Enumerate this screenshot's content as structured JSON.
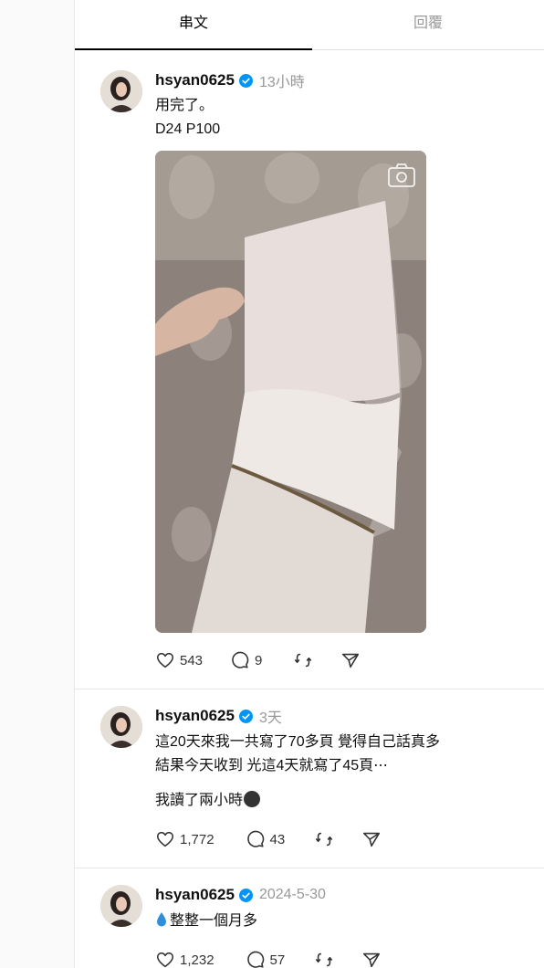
{
  "tabs": [
    {
      "label": "串文",
      "active": true
    },
    {
      "label": "回覆",
      "active": false
    }
  ],
  "posts": [
    {
      "username": "hsyan0625",
      "time": "13小時",
      "lines": [
        "用完了。",
        "D24 P100"
      ],
      "has_image": true,
      "likes": "543",
      "comments": "9"
    },
    {
      "username": "hsyan0625",
      "time": "3天",
      "lines": [
        "這20天來我一共寫了70多頁 覺得自己話真多",
        "結果今天收到 光這4天就寫了45頁⋯",
        "我讀了兩小時"
      ],
      "likes": "1,772",
      "comments": "43"
    },
    {
      "username": "hsyan0625",
      "time": "2024-5-30",
      "lines": [
        "整整一個月多"
      ],
      "likes": "1,232",
      "comments": "57"
    }
  ],
  "colors": {
    "verified": "#0095f6",
    "muted": "#999999",
    "divider": "#e6e6e6"
  },
  "icons": [
    "heart-icon",
    "comment-icon",
    "repost-icon",
    "share-icon",
    "camera-icon",
    "verified-badge-icon",
    "droplet-icon",
    "face-emoji-icon"
  ]
}
